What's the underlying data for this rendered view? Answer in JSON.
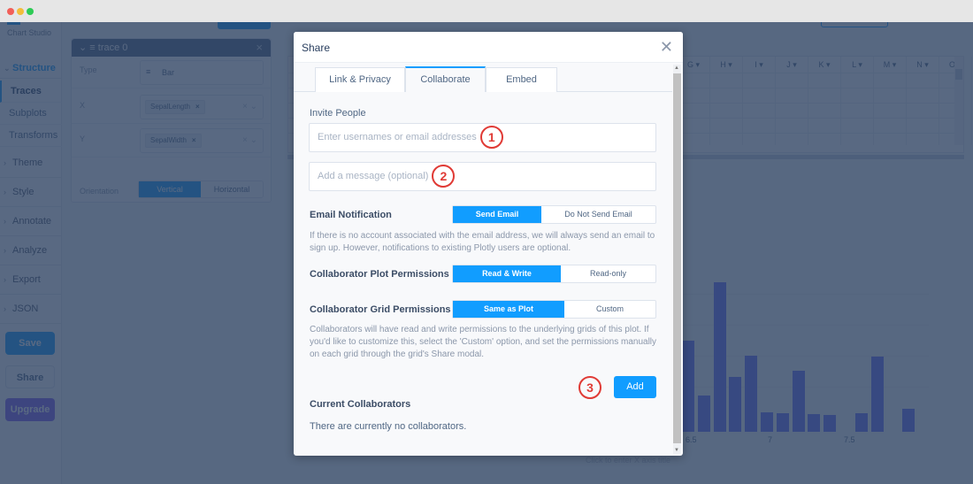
{
  "window": {
    "controls": [
      "close",
      "minimize",
      "maximize"
    ]
  },
  "sidebar": {
    "brand": "Chart Studio",
    "sections": [
      {
        "label": "Structure",
        "expanded": true
      },
      {
        "label": "Theme",
        "expanded": false
      },
      {
        "label": "Style",
        "expanded": false
      },
      {
        "label": "Annotate",
        "expanded": false
      },
      {
        "label": "Analyze",
        "expanded": false
      },
      {
        "label": "Export",
        "expanded": false
      },
      {
        "label": "JSON",
        "expanded": false
      }
    ],
    "structure_items": [
      {
        "label": "Traces",
        "active": true
      },
      {
        "label": "Subplots",
        "active": false
      },
      {
        "label": "Transforms",
        "active": false
      }
    ],
    "buttons": {
      "save": "Save",
      "share": "Share",
      "upgrade": "Upgrade"
    }
  },
  "trace_panel": {
    "title": "trace 0",
    "type_label": "Type",
    "type_value": "Bar",
    "x_label": "X",
    "x_value": "SepalLength",
    "y_label": "Y",
    "y_value": "SepalWidth",
    "orientation_label": "Orientation",
    "orientation_options": [
      "Vertical",
      "Horizontal"
    ],
    "orientation_selected": "Vertical"
  },
  "grid": {
    "columns": [
      "G",
      "H",
      "I",
      "J",
      "K",
      "L",
      "M",
      "N",
      "O"
    ]
  },
  "chart_data": {
    "type": "bar",
    "x": [
      6.5,
      6.6,
      6.7,
      6.8,
      6.9,
      7.0,
      7.1,
      7.2,
      7.3,
      7.4,
      7.6,
      7.7,
      7.9
    ],
    "values": [
      3.0,
      1.2,
      4.9,
      1.8,
      2.5,
      0.65,
      0.6,
      2.0,
      0.58,
      0.55,
      0.6,
      2.45,
      0.75
    ],
    "xticks": [
      "6.5",
      "7",
      "7.5"
    ],
    "xlabel": "Click to enter X axis title",
    "color": "#636efa"
  },
  "modal": {
    "title": "Share",
    "tabs": [
      {
        "label": "Link & Privacy",
        "active": false
      },
      {
        "label": "Collaborate",
        "active": true
      },
      {
        "label": "Embed",
        "active": false
      }
    ],
    "invite_label": "Invite People",
    "invite_placeholder": "Enter usernames or email addresses",
    "invite_value": "",
    "message_placeholder": "Add a message (optional)",
    "message_value": "",
    "email_notification": {
      "label": "Email Notification",
      "options": [
        "Send Email",
        "Do Not Send Email"
      ],
      "selected": "Send Email",
      "help": "If there is no account associated with the email address, we will always send an email to sign up. However, notifications to existing Plotly users are optional."
    },
    "plot_permissions": {
      "label": "Collaborator Plot Permissions",
      "options": [
        "Read & Write",
        "Read-only"
      ],
      "selected": "Read & Write"
    },
    "grid_permissions": {
      "label": "Collaborator Grid Permissions",
      "options": [
        "Same as Plot",
        "Custom"
      ],
      "selected": "Same as Plot",
      "help": "Collaborators will have read and write permissions to the underlying grids of this plot. If you'd like to customize this, select the 'Custom' option, and set the permissions manually on each grid through the grid's Share modal."
    },
    "add_button": "Add",
    "current_collaborators_label": "Current Collaborators",
    "current_collaborators_empty": "There are currently no collaborators."
  },
  "annotations": [
    "1",
    "2",
    "3"
  ],
  "colors": {
    "accent": "#119dff",
    "annotation": "#e03a35",
    "upgrade": "#7e5bef",
    "overlay": "#2a3f5f"
  }
}
